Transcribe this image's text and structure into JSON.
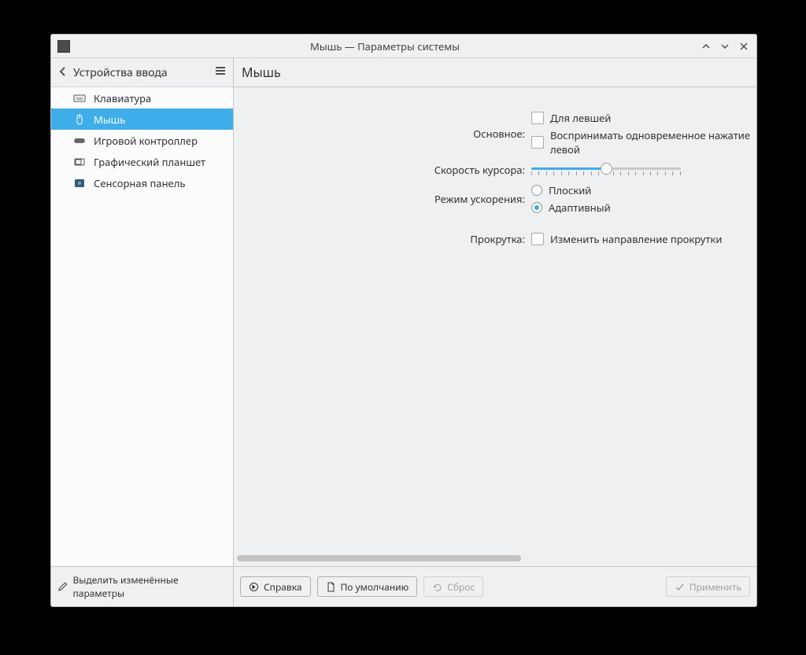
{
  "window": {
    "title": "Мышь — Параметры системы"
  },
  "sidebar": {
    "header": "Устройства ввода",
    "items": [
      {
        "label": "Клавиатура"
      },
      {
        "label": "Мышь"
      },
      {
        "label": "Игровой контроллер"
      },
      {
        "label": "Графический планшет"
      },
      {
        "label": "Сенсорная панель"
      }
    ]
  },
  "main": {
    "title": "Мышь"
  },
  "form": {
    "primary_label": "Основное:",
    "left_handed": "Для левшей",
    "simultaneous": "Воспринимать одновременное нажатие левой",
    "pointer_speed_label": "Скорость курсора:",
    "accel_mode_label": "Режим ускорения:",
    "accel_flat": "Плоский",
    "accel_adaptive": "Адаптивный",
    "scroll_label": "Прокрутка:",
    "invert_scroll": "Изменить направление прокрутки"
  },
  "footer": {
    "highlight_changed": "Выделить изменённые параметры",
    "help": "Справка",
    "defaults": "По умолчанию",
    "reset": "Сброс",
    "apply": "Применить"
  }
}
